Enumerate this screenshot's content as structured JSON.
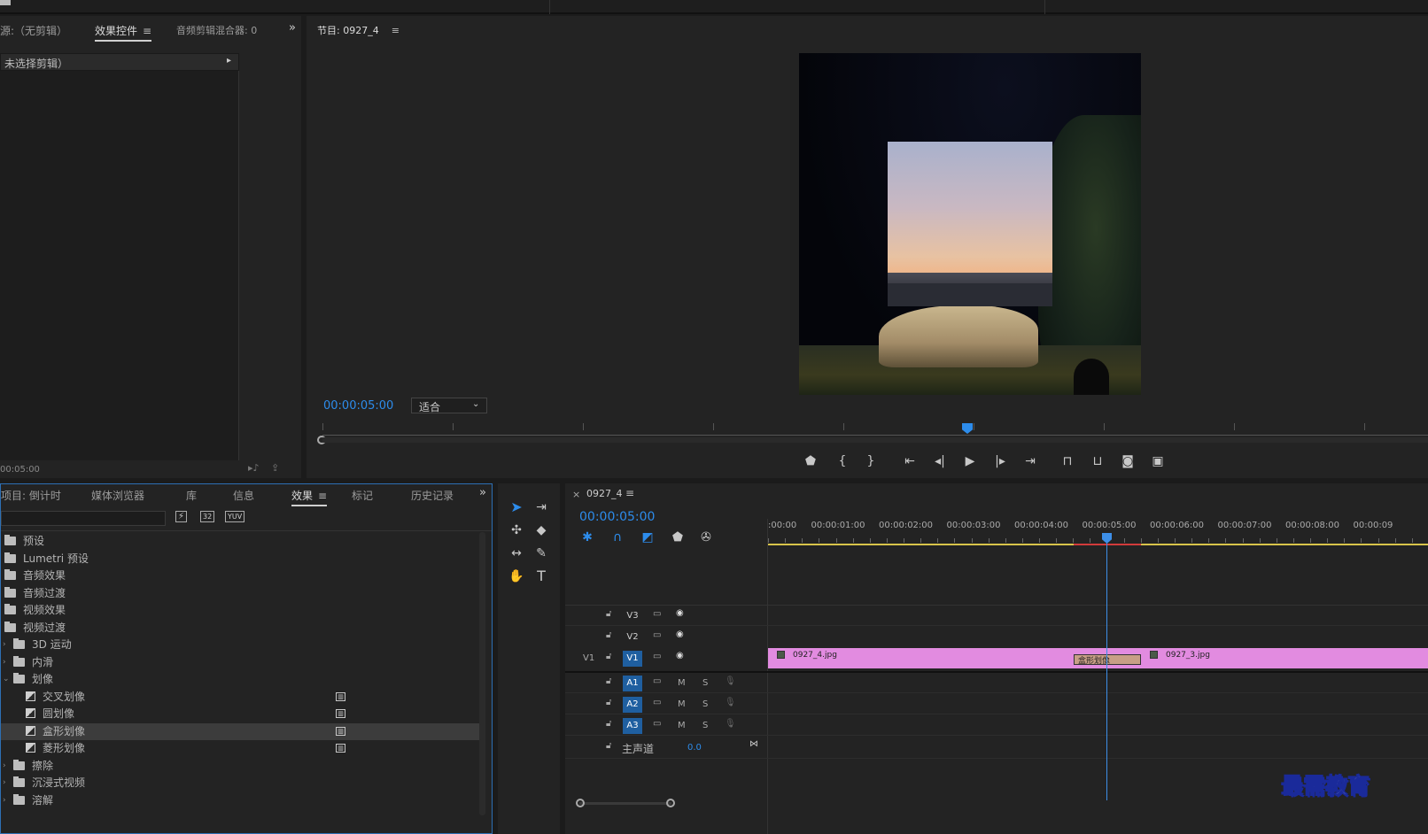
{
  "effect_controls_panel": {
    "source_label": "源:（无剪辑）",
    "tab_effect_controls": "效果控件",
    "tab_audio_mixer": "音频剪辑混合器: 0",
    "no_clip_selected": "未选择剪辑）",
    "time": "00:05:00"
  },
  "program_monitor": {
    "title": "节目: 0927_4",
    "timecode": "00:00:05:00",
    "fit_label": "适合"
  },
  "project_panel": {
    "tabs": [
      "项目: 倒计时",
      "媒体浏览器",
      "库",
      "信息",
      "效果",
      "标记",
      "历史记录"
    ],
    "active_tab": "效果",
    "effects_tree": [
      {
        "label": "预设",
        "indent": 0,
        "kind": "folder"
      },
      {
        "label": "Lumetri 预设",
        "indent": 0,
        "kind": "folder"
      },
      {
        "label": "音频效果",
        "indent": 0,
        "kind": "folder"
      },
      {
        "label": "音频过渡",
        "indent": 0,
        "kind": "folder"
      },
      {
        "label": "视频效果",
        "indent": 0,
        "kind": "folder"
      },
      {
        "label": "视频过渡",
        "indent": 0,
        "kind": "folder"
      },
      {
        "label": "3D 运动",
        "indent": 1,
        "kind": "folder"
      },
      {
        "label": "内滑",
        "indent": 1,
        "kind": "folder"
      },
      {
        "label": "划像",
        "indent": 1,
        "kind": "folder"
      },
      {
        "label": "交叉划像",
        "indent": 2,
        "kind": "effect"
      },
      {
        "label": "圆划像",
        "indent": 2,
        "kind": "effect"
      },
      {
        "label": "盒形划像",
        "indent": 2,
        "kind": "effect",
        "selected": true
      },
      {
        "label": "菱形划像",
        "indent": 2,
        "kind": "effect"
      },
      {
        "label": "擦除",
        "indent": 1,
        "kind": "folder"
      },
      {
        "label": "沉浸式视频",
        "indent": 1,
        "kind": "folder"
      },
      {
        "label": "溶解",
        "indent": 1,
        "kind": "folder"
      }
    ]
  },
  "timeline": {
    "sequence_name": "0927_4",
    "close_glyph": "×",
    "timecode": "00:00:05:00",
    "ruler_labels": [
      ":00:00",
      "00:00:01:00",
      "00:00:02:00",
      "00:00:03:00",
      "00:00:04:00",
      "00:00:05:00",
      "00:00:06:00",
      "00:00:07:00",
      "00:00:08:00",
      "00:00:09"
    ],
    "tracks": {
      "v3": "V3",
      "v2": "V2",
      "v1_source": "V1",
      "v1": "V1",
      "a1": "A1",
      "a2": "A2",
      "a3": "A3",
      "mute": "M",
      "solo": "S",
      "master_label": "主声道",
      "master_value": "0.0"
    },
    "clip_1": "0927_4.jpg",
    "clip_2": "0927_3.jpg",
    "transition_label": "盒形划像"
  },
  "watermark": "最需教育",
  "colors": {
    "accent": "#2d8ceb",
    "clip": "#e28be0",
    "transition": "#c89f86",
    "work_area": "#d8c44a"
  }
}
